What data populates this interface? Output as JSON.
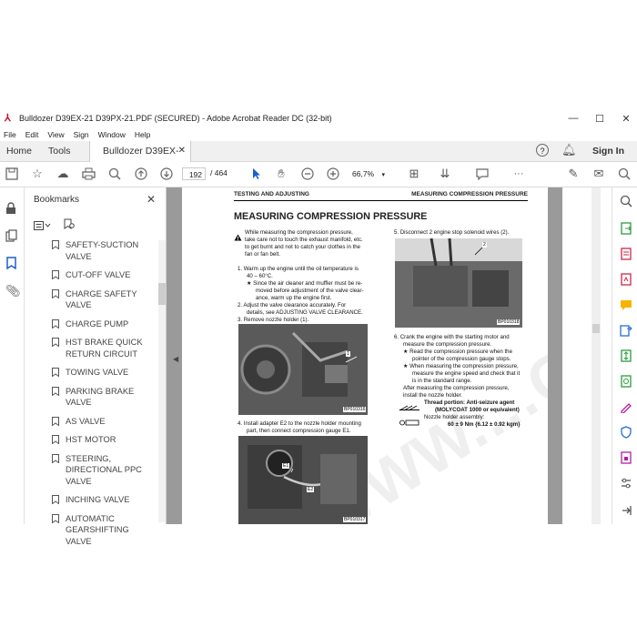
{
  "window": {
    "title": "Bulldozer D39EX-21 D39PX-21.PDF (SECURED) - Adobe Acrobat Reader DC (32-bit)"
  },
  "menu": [
    "File",
    "Edit",
    "View",
    "Sign",
    "Window",
    "Help"
  ],
  "tabs": {
    "home": "Home",
    "tools": "Tools",
    "document": "Bulldozer D39EX-2...",
    "sign_in": "Sign In"
  },
  "toolbar": {
    "page_current": "192",
    "page_total": "/ 464",
    "zoom": "66,7%"
  },
  "bookmarks": {
    "title": "Bookmarks",
    "items": [
      "SAFETY-SUCTION VALVE",
      "CUT-OFF VALVE",
      "CHARGE SAFETY VALVE",
      "CHARGE PUMP",
      "HST BRAKE QUICK RETURN CIRCUIT",
      "TOWING VALVE",
      "PARKING BRAKE VALVE",
      "AS VALVE",
      "HST MOTOR",
      "STEERING, DIRECTIONAL PPC VALVE",
      "INCHING VALVE",
      "AUTOMATIC GEARSHIFTING VALVE"
    ]
  },
  "page": {
    "header_left": "TESTING AND ADJUSTING",
    "header_right": "MEASURING COMPRESSION PRESSURE",
    "title": "MEASURING COMPRESSION PRESSURE",
    "warn1": "While measuring the compression pressure,",
    "warn2": "take care not to touch the exhaust manifold, etc.",
    "warn3": "to get burnt and not to catch your clothes in the",
    "warn4": "fan or fan belt.",
    "s1a": "1.  Warm up the engine until the oil temperature is",
    "s1b": "40 – 60°C.",
    "s1c": "★  Since the air cleaner and muffler must be re-",
    "s1d": "moved before adjustment of the valve clear-",
    "s1e": "ance, warm up the engine first.",
    "s2a": "2.  Adjust the valve clearance accurately.   For",
    "s2b": "details, see ADJUSTING VALVE CLEARANCE.",
    "s3": "3.  Remove nozzle holder (1).",
    "photo1": "BP010316",
    "s4a": "4.  Install adapter E2 to the nozzle holder mounting",
    "s4b": "part, then connect compression gauge E1.",
    "photo2": "BP010317",
    "s5": "5.  Disconnect 2 engine stop solenoid wires (2).",
    "photo3": "BP010318",
    "s6a": "6.  Crank the engine with the starting motor and",
    "s6b": "measure the compression pressure.",
    "s6c": "★  Read the compression pressure when the",
    "s6d": "pointer of the compression gauge stops.",
    "s6e": "★  When measuring the compression pressure,",
    "s6f": "measure the engine speed and check that it",
    "s6g": "is in the standard range.",
    "s6h": "After measuring the compression pressure,",
    "s6i": "install the nozzle holder.",
    "thread_a": "Thread portion: Anti-seizure agent",
    "thread_b": "(MOLYCOAT 1000 or equivalent)",
    "nozzle_a": "Nozzle holder assembly:",
    "nozzle_b": "60 ± 9 Nm {6.12 ± 0.92 kgm}",
    "label_1": "1",
    "label_2": "2",
    "label_e1": "E1",
    "label_e2": "E2"
  }
}
